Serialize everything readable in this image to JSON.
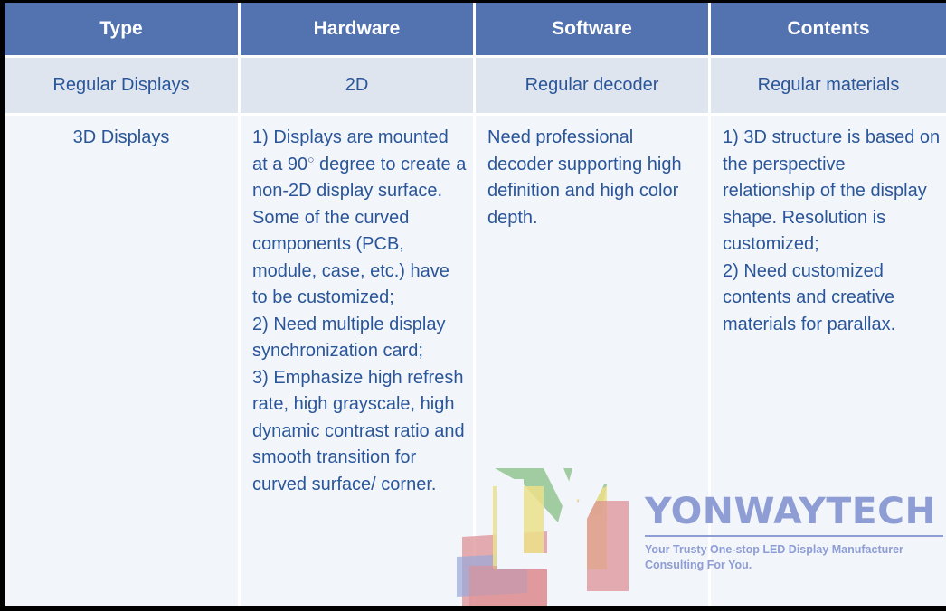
{
  "table": {
    "headers": [
      {
        "label": "Type"
      },
      {
        "label": "Hardware"
      },
      {
        "label": "Software"
      },
      {
        "label": "Contents"
      }
    ],
    "rows": [
      {
        "name": "regular-displays",
        "cells": [
          "Regular Displays",
          "2D",
          "Regular decoder",
          "Regular materials"
        ]
      },
      {
        "name": "3d-displays",
        "cells": [
          "3D Displays",
          "1) Displays are mounted at a 90",
          "Need professional decoder supporting high definition and high color depth.",
          "1) 3D structure is based on the perspective relationship of the display shape. Resolution is customized;\n2) Need customized contents and creative materials for parallax."
        ],
        "hardware_after_degree": " degree to create a non-2D display surface. Some of the curved components (PCB, module, case, etc.) have to be customized;\n2) Need multiple display synchronization card;\n3) Emphasize high refresh rate, high grayscale, high dynamic contrast ratio and smooth transition for curved surface/ corner.",
        "degree_symbol": "○"
      }
    ]
  },
  "watermark": {
    "brand": "YONWAYTECH",
    "tagline": "Your Trusty One-stop LED Display Manufacturer\nConsulting For You."
  },
  "colors": {
    "header_blue": "#5273b0",
    "row_alt": "#dfe5ef",
    "body_bg": "#f2f5fa",
    "text_blue": "#2a5699",
    "watermark_blue": "#8e9dd4",
    "logo_green": "#8cc08a",
    "logo_yellow": "#ece08a",
    "logo_red": "#dd8f92",
    "logo_blue": "#98a8da"
  }
}
